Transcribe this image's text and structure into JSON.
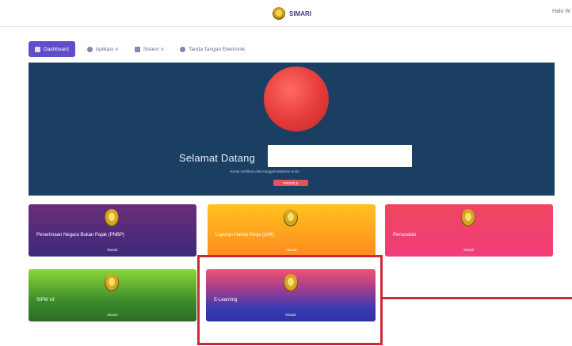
{
  "header": {
    "brand_name": "SIMARI",
    "user_label": "Halo W"
  },
  "nav": {
    "items": [
      {
        "label": "Dashboard",
        "icon": "home-icon"
      },
      {
        "label": "Aplikasi ∨",
        "icon": "grid-icon"
      },
      {
        "label": "Sistem ∨",
        "icon": "monitor-icon"
      },
      {
        "label": "Tanda Tangan Elektronik",
        "icon": "pen-icon"
      }
    ]
  },
  "hero": {
    "welcome": "Selamat Datang",
    "subtitle": "Harap verifikasi data tanggal kelahiran anda",
    "button": "PROFILE"
  },
  "cards": [
    {
      "title": "Penerimaan Negara Bukan Pajak (PNBP)",
      "action": "Masuk"
    },
    {
      "title": "Laporan Harian Kerja (LHK)",
      "action": "Masuk"
    },
    {
      "title": "Persuratan",
      "action": "Masuk"
    },
    {
      "title": "SIPM v3",
      "action": "Masuk"
    },
    {
      "title": "E-Learning",
      "action": "Masuk"
    }
  ],
  "colors": {
    "accent": "#5e4fc9",
    "hero_bg": "#1b3f63",
    "highlight": "#cc2a37"
  }
}
